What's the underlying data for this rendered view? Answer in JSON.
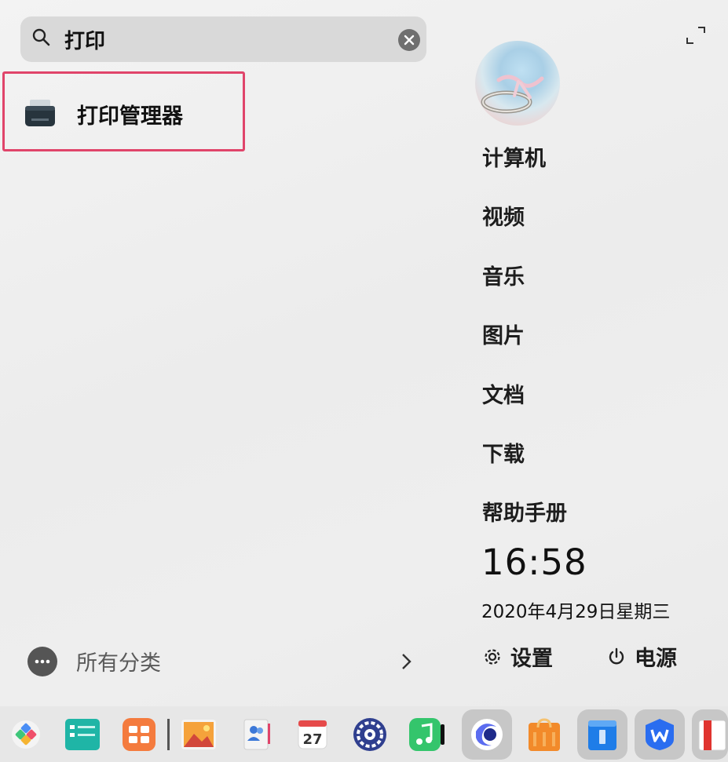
{
  "search": {
    "value": "打印",
    "placeholder": ""
  },
  "results": [
    {
      "label": "打印管理器",
      "icon": "printer-icon"
    }
  ],
  "categories": {
    "label": "所有分类"
  },
  "nav": {
    "computer": "计算机",
    "video": "视频",
    "music": "音乐",
    "pictures": "图片",
    "documents": "文档",
    "downloads": "下载",
    "help": "帮助手册"
  },
  "clock": {
    "time": "16:58",
    "date": "2020年4月29日星期三"
  },
  "actions": {
    "settings": "设置",
    "power": "电源"
  },
  "dock": {
    "calendar_day": "27",
    "items": [
      "launcher-icon",
      "file-manager-icon",
      "app-store-icon",
      "image-viewer-icon",
      "contacts-icon",
      "calendar-icon",
      "settings-icon",
      "music-icon",
      "browser-icon",
      "shop-icon",
      "notes-icon",
      "wps-icon",
      "book-icon"
    ]
  },
  "colors": {
    "highlight_border": "#e0446a",
    "search_bg": "#d9d9d9"
  }
}
